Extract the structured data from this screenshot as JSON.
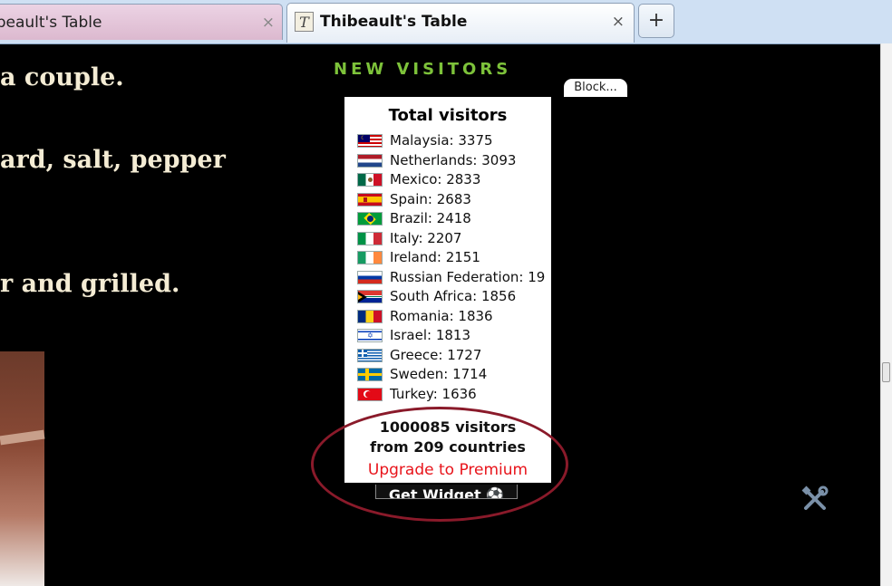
{
  "tabs": [
    {
      "title": "ibeault's Table",
      "close": "×"
    },
    {
      "title": "Thibeault's Table",
      "close": "×",
      "favicon": "T"
    }
  ],
  "new_tab_label": "+",
  "recipe_lines": [
    "a couple.",
    "ard, salt, pepper",
    "r  and grilled."
  ],
  "widget": {
    "header": "NEW VISITORS",
    "block_label": "Block...",
    "title": "Total visitors",
    "countries": [
      {
        "label": "Malaysia: 3375",
        "flag": "malaysia-flag-icon"
      },
      {
        "label": "Netherlands: 3093",
        "flag": "netherlands-flag-icon"
      },
      {
        "label": "Mexico: 2833",
        "flag": "mexico-flag-icon"
      },
      {
        "label": "Spain: 2683",
        "flag": "spain-flag-icon"
      },
      {
        "label": "Brazil: 2418",
        "flag": "brazil-flag-icon"
      },
      {
        "label": "Italy: 2207",
        "flag": "italy-flag-icon"
      },
      {
        "label": "Ireland: 2151",
        "flag": "ireland-flag-icon"
      },
      {
        "label": "Russian Federation: 19",
        "flag": "russia-flag-icon"
      },
      {
        "label": "South Africa: 1856",
        "flag": "south-africa-flag-icon"
      },
      {
        "label": "Romania: 1836",
        "flag": "romania-flag-icon"
      },
      {
        "label": "Israel: 1813",
        "flag": "israel-flag-icon"
      },
      {
        "label": "Greece: 1727",
        "flag": "greece-flag-icon"
      },
      {
        "label": "Sweden: 1714",
        "flag": "sweden-flag-icon"
      },
      {
        "label": "Turkey: 1636",
        "flag": "turkey-flag-icon"
      }
    ],
    "summary_visitors": "1000085 visitors",
    "summary_countries": "from 209 countries",
    "upgrade_label": "Upgrade to Premium",
    "get_widget_label": "Get Widget",
    "highlight_color": "#8a1a2a",
    "accent_color": "#7dc23a",
    "link_color": "#e8141b"
  }
}
